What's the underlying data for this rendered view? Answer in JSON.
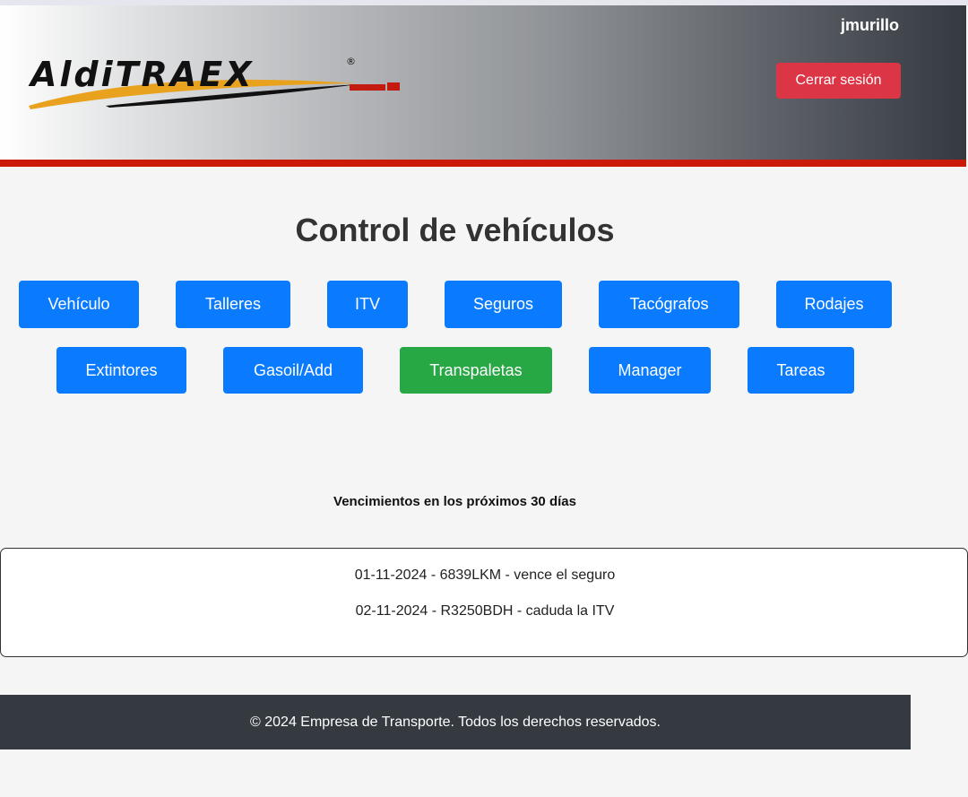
{
  "header": {
    "username": "jmurillo",
    "logout_label": "Cerrar sesión",
    "logo_text": "AldiTRAEX",
    "logo_mark": "®"
  },
  "page_title": "Control de vehículos",
  "nav": {
    "row1": [
      "Vehículo",
      "Talleres",
      "ITV",
      "Seguros",
      "Tacógrafos",
      "Rodajes"
    ],
    "row2": [
      "Extintores",
      "Gasoil/Add",
      "Transpaletas",
      "Manager",
      "Tareas"
    ],
    "active": "Transpaletas"
  },
  "expirations": {
    "title": "Vencimientos en los próximos 30 días",
    "items": [
      "01-11-2024 - 6839LKM - vence el seguro",
      "02-11-2024 - R3250BDH - caduda la ITV"
    ]
  },
  "footer": {
    "text": "© 2024 Empresa de Transporte. Todos los derechos reservados."
  },
  "colors": {
    "primary": "#0a7bff",
    "active": "#28a745",
    "danger": "#dc3545",
    "accent_red": "#cc1a08",
    "dark": "#343a40"
  }
}
